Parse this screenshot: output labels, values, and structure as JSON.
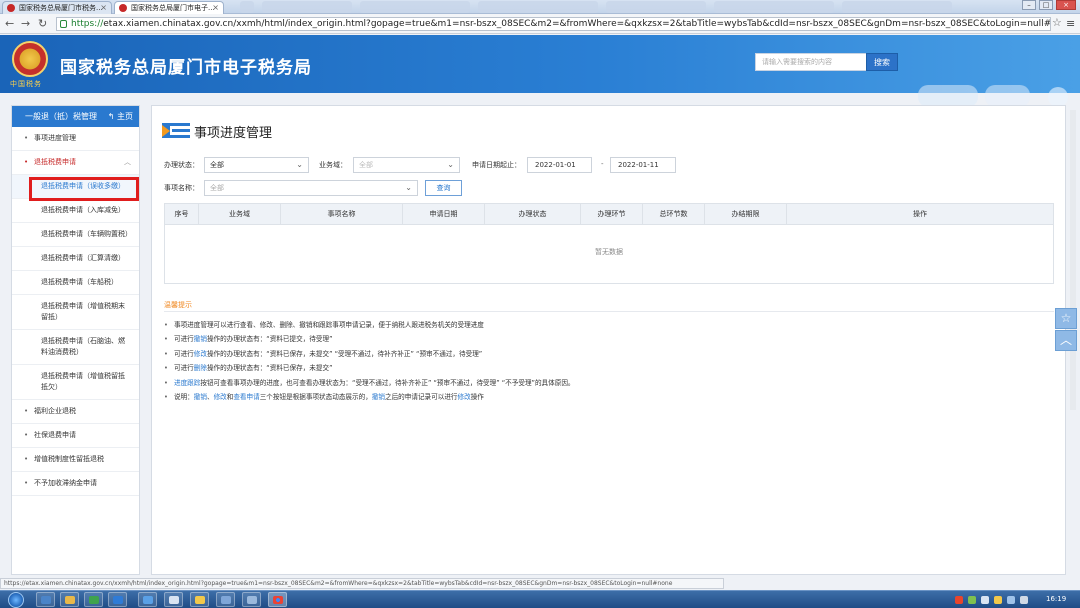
{
  "browser": {
    "tabs": [
      {
        "label": "国家税务总局厦门市税务..."
      },
      {
        "label": "国家税务总局厦门市电子..."
      }
    ],
    "url_proto": "https://",
    "url_rest": "etax.xiamen.chinatax.gov.cn/xxmh/html/index_origin.html?gopage=true&m1=nsr-bszx_08SEC&m2=&fromWhere=&qxkzsx=2&tabTitle=wybsTab&cdId=nsr-bszx_08SEC&gnDm=nsr-bszx_08SEC&toLogin=null#none",
    "status_url": "https://etax.xiamen.chinatax.gov.cn/xxmh/html/index_origin.html?gopage=true&m1=nsr-bszx_08SEC&m2=&fromWhere=&qxkzsx=2&tabTitle=wybsTab&cdId=nsr-bszx_08SEC&gnDm=nsr-bszx_08SEC&toLogin=null#none"
  },
  "header": {
    "site_title": "国家税务总局厦门市电子税务局",
    "emblem_caption": "中国税务",
    "search_placeholder": "请输入需要搜索的内容",
    "search_button": "搜索"
  },
  "sidebar": {
    "head_label": "一般退（抵）税管理",
    "home_label": "主页",
    "items": [
      {
        "label": "事项进度管理"
      },
      {
        "label": "退抵税费申请"
      },
      {
        "label": "退抵税费申请（误收多缴）"
      },
      {
        "label": "退抵税费申请（入库减免）"
      },
      {
        "label": "退抵税费申请（车辆购置税）"
      },
      {
        "label": "退抵税费申请（汇算清缴）"
      },
      {
        "label": "退抵税费申请（车船税）"
      },
      {
        "label": "退抵税费申请（增值税期末留抵）"
      },
      {
        "label": "退抵税费申请（石脑油、燃料油消费税）"
      },
      {
        "label": "退抵税费申请（增值税留抵抵欠）"
      },
      {
        "label": "福利企业退税"
      },
      {
        "label": "社保退费申请"
      },
      {
        "label": "增值税制度性留抵退税"
      },
      {
        "label": "不予加收滞纳金申请"
      }
    ]
  },
  "main": {
    "page_title": "事项进度管理",
    "filters": {
      "status_label": "办理状态：",
      "status_value": "全部",
      "domain_label": "业务域：",
      "domain_value": "全部",
      "date_label": "申请日期起止：",
      "date_from": "2022-01-01",
      "date_sep": "-",
      "date_to": "2022-01-11",
      "item_label": "事项名称：",
      "item_value": "全部",
      "query_button": "查询"
    },
    "table": {
      "columns": [
        "序号",
        "业务域",
        "事项名称",
        "申请日期",
        "办理状态",
        "办理环节",
        "总环节数",
        "办结期限",
        "操作"
      ],
      "empty_text": "暂无数据"
    },
    "tips": {
      "title": "温馨提示",
      "lines": [
        {
          "segs": [
            {
              "t": "事项进度管理可以进行查看、修改、删除、撤销和跟踪事项申请记录，便于纳税人跟进税务机关的受理进度"
            }
          ]
        },
        {
          "segs": [
            {
              "t": "可进行"
            },
            {
              "t": "撤销",
              "b": true
            },
            {
              "t": "操作的办理状态有：“资料已提交，待受理”"
            }
          ]
        },
        {
          "segs": [
            {
              "t": "可进行"
            },
            {
              "t": "修改",
              "b": true
            },
            {
              "t": "操作的办理状态有：“资料已保存，未提交”  “受理不通过，待补齐补正”  “预审不通过，待受理”"
            }
          ]
        },
        {
          "segs": [
            {
              "t": "可进行"
            },
            {
              "t": "删除",
              "b": true
            },
            {
              "t": "操作的办理状态有：“资料已保存，未提交”"
            }
          ]
        },
        {
          "segs": [
            {
              "t": "进度跟踪",
              "b": true
            },
            {
              "t": "按钮可查看事项办理的进度，也可查看办理状态为：“受理不通过，待补齐补正”  “预审不通过，待受理”  “不予受理”的具体原因。"
            }
          ]
        },
        {
          "segs": [
            {
              "t": "说明："
            },
            {
              "t": "撤销",
              "b": true
            },
            {
              "t": "、"
            },
            {
              "t": "修改",
              "b": true
            },
            {
              "t": "和"
            },
            {
              "t": "查看申请",
              "b": true
            },
            {
              "t": "三个按钮是根据事项状态动态展示的，"
            },
            {
              "t": "撤销",
              "b": true
            },
            {
              "t": "之后的申请记录可以进行"
            },
            {
              "t": "修改",
              "b": true
            },
            {
              "t": "操作"
            }
          ]
        }
      ]
    }
  },
  "taskbar": {
    "clock": "16:19"
  },
  "colors": {
    "brand_blue": "#2a79cf",
    "highlight_red": "#e01d1d",
    "tip_orange": "#f08a24",
    "open_red": "#c62828"
  }
}
